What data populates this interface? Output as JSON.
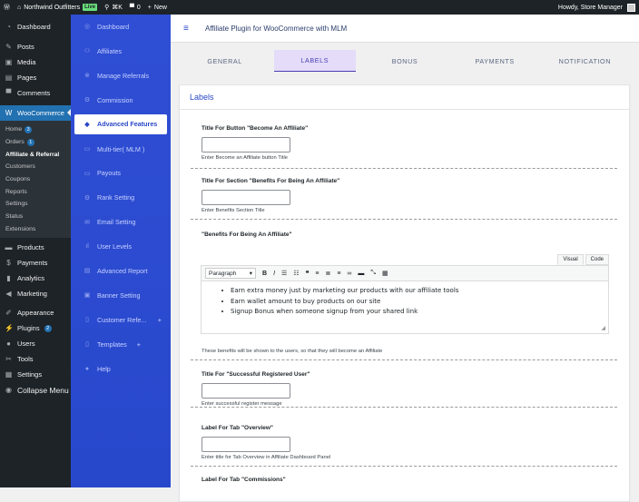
{
  "adminbar": {
    "site_name": "Northwind Outfitters",
    "live_label": "Live",
    "shortcut": "⌘K",
    "comments_count": "0",
    "new_label": "New",
    "howdy": "Howdy, Store Manager"
  },
  "wp_menu": {
    "items_top": [
      {
        "label": "Dashboard",
        "icon": "gauge-icon"
      },
      {
        "label": "Posts",
        "icon": "pin-icon"
      },
      {
        "label": "Media",
        "icon": "media-icon"
      },
      {
        "label": "Pages",
        "icon": "pages-icon"
      },
      {
        "label": "Comments",
        "icon": "comment-icon"
      }
    ],
    "woocommerce": "WooCommerce",
    "sub": [
      {
        "label": "Home",
        "badge": "3"
      },
      {
        "label": "Orders",
        "badge": "1"
      },
      {
        "label": "Affiliate & Referral"
      },
      {
        "label": "Customers"
      },
      {
        "label": "Coupons"
      },
      {
        "label": "Reports"
      },
      {
        "label": "Settings"
      },
      {
        "label": "Status"
      },
      {
        "label": "Extensions"
      }
    ],
    "items_bottom": [
      {
        "label": "Products"
      },
      {
        "label": "Payments"
      },
      {
        "label": "Analytics"
      },
      {
        "label": "Marketing"
      },
      {
        "label": "Appearance"
      },
      {
        "label": "Plugins",
        "badge": "2"
      },
      {
        "label": "Users"
      },
      {
        "label": "Tools"
      },
      {
        "label": "Settings"
      },
      {
        "label": "Collapse Menu"
      }
    ]
  },
  "plugin_nav": [
    {
      "label": "Dashboard"
    },
    {
      "label": "Affiliates"
    },
    {
      "label": "Manage Referrals"
    },
    {
      "label": "Commission"
    },
    {
      "label": "Advanced Features"
    },
    {
      "label": "Multi-tier( MLM )"
    },
    {
      "label": "Payouts"
    },
    {
      "label": "Rank Setting"
    },
    {
      "label": "Email Setting"
    },
    {
      "label": "User Levels"
    },
    {
      "label": "Advanced Report"
    },
    {
      "label": "Banner Setting"
    },
    {
      "label": "Customer Refe...",
      "plus": "+"
    },
    {
      "label": "Templates",
      "plus": "+"
    },
    {
      "label": "Help"
    }
  ],
  "page_title": "Affiliate Plugin for WooCommerce with MLM",
  "tabs": [
    "GENERAL",
    "LABELS",
    "BONUS",
    "PAYMENTS",
    "NOTIFICATION"
  ],
  "card_title": "Labels",
  "fields": [
    {
      "title": "Title For Button \"Become An Affiliate\"",
      "desc": "Enter Become an Affiliate button Title"
    },
    {
      "title": "Title For Section \"Benefits For Being An Affiliate\"",
      "desc": "Enter Benefits Section Title"
    },
    {
      "title": "\"Benefits For Being An Affiliate\"",
      "desc": "These benefits will be shown to the users, so that they will become an Affiliate"
    },
    {
      "title": "Title For \"Successful Registered User\"",
      "desc": "Enter successful register message"
    },
    {
      "title": "Label For Tab \"Overview\"",
      "desc": "Enter title for Tab Overview in Affiliate Dashboard Panel"
    },
    {
      "title": "Label For Tab \"Commissions\""
    }
  ],
  "editor": {
    "tab_visual": "Visual",
    "tab_code": "Code",
    "paragraph": "Paragraph",
    "bullets": [
      "Earn extra money just by marketing our products with our affiliate tools",
      "Earn wallet amount to buy products on our site",
      "Signup Bonus when someone signup from your shared link"
    ]
  },
  "colors": {
    "accent": "#2a47c8",
    "wp_blue": "#2271b1",
    "admin_dark": "#1d2327"
  }
}
